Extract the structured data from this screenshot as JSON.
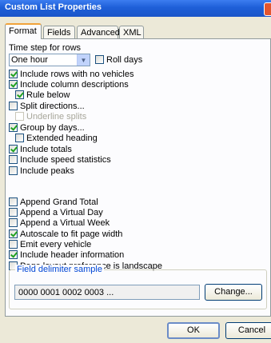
{
  "window": {
    "title": "Custom List Properties"
  },
  "tabs": [
    {
      "label": "Format",
      "active": true
    },
    {
      "label": "Fields",
      "active": false
    },
    {
      "label": "Advanced",
      "active": false
    },
    {
      "label": "XML",
      "active": false
    }
  ],
  "format": {
    "time_step_label": "Time step for rows",
    "time_step_value": "One hour",
    "roll_days": {
      "label": "Roll days",
      "checked": false
    },
    "options": [
      {
        "label": "Include rows with no vehicles",
        "checked": true,
        "enabled": true
      },
      {
        "label": "Include column descriptions",
        "checked": true,
        "enabled": true
      },
      {
        "label": "Rule below",
        "checked": true,
        "enabled": true
      },
      {
        "label": "Split directions...",
        "checked": false,
        "enabled": true
      },
      {
        "label": "Underline splits",
        "checked": false,
        "enabled": false
      },
      {
        "label": "Group by days...",
        "checked": true,
        "enabled": true
      },
      {
        "label": "Extended heading",
        "checked": false,
        "enabled": true
      },
      {
        "label": "Include totals",
        "checked": true,
        "enabled": true
      },
      {
        "label": "Include speed statistics",
        "checked": false,
        "enabled": true
      },
      {
        "label": "Include peaks",
        "checked": false,
        "enabled": true
      },
      {
        "label": "Append Grand Total",
        "checked": false,
        "enabled": true
      },
      {
        "label": "Append a Virtual Day",
        "checked": false,
        "enabled": true
      },
      {
        "label": "Append a Virtual Week",
        "checked": false,
        "enabled": true
      },
      {
        "label": "Autoscale to fit page width",
        "checked": true,
        "enabled": true
      },
      {
        "label": "Emit every vehicle",
        "checked": false,
        "enabled": true
      },
      {
        "label": "Include header information",
        "checked": true,
        "enabled": true
      },
      {
        "label": "Page layout preference is landscape",
        "checked": false,
        "enabled": true
      }
    ],
    "delimiter_group_title": "Field delimiter sample",
    "delimiter_sample": "0000 0001 0002 0003  ...",
    "change_label": "Change..."
  },
  "buttons": {
    "ok": "OK",
    "cancel": "Cancel"
  },
  "colors": {
    "title_bar": "#1e5fd8",
    "dialog_bg": "#ece9d8",
    "group_title": "#0046d5",
    "check_mark": "#21a121"
  }
}
